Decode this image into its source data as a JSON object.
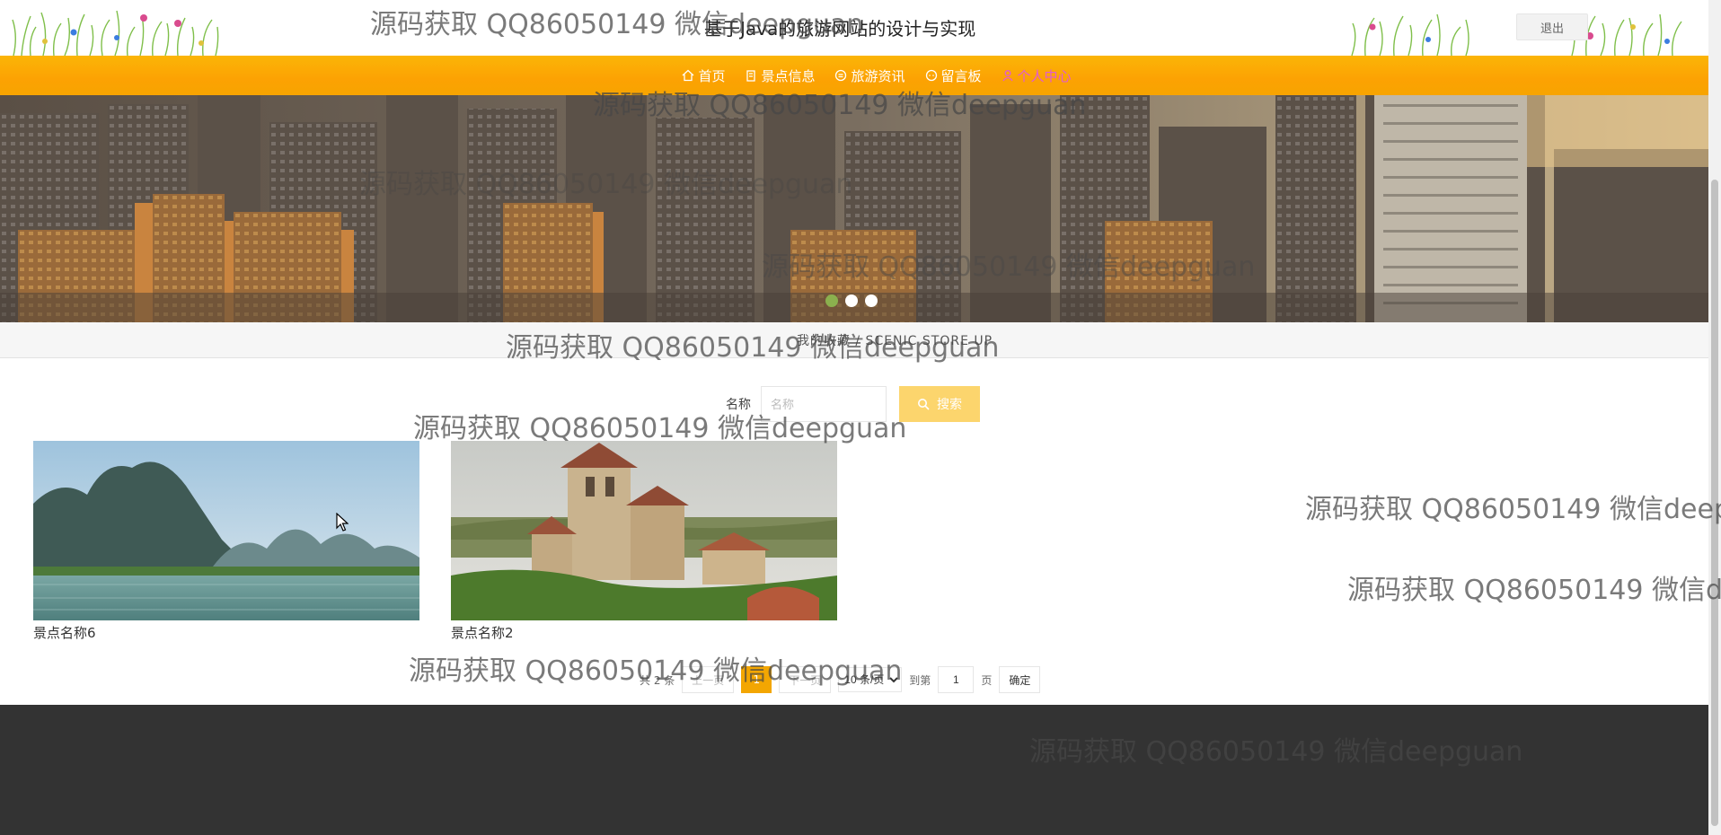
{
  "header": {
    "title": "基于Java的旅游网站的设计与实现",
    "logout_label": "退出"
  },
  "nav": {
    "items": [
      {
        "label": "首页",
        "icon": "home-icon"
      },
      {
        "label": "景点信息",
        "icon": "building-icon"
      },
      {
        "label": "旅游资讯",
        "icon": "news-icon"
      },
      {
        "label": "留言板",
        "icon": "message-icon"
      },
      {
        "label": "个人中心",
        "icon": "user-icon"
      }
    ],
    "active_index": 4
  },
  "banner": {
    "slide_count": 3,
    "active_slide": 0
  },
  "subbar": {
    "text": "我的收藏 / SCENIC STORE UP"
  },
  "search": {
    "label": "名称",
    "placeholder": "名称",
    "value": "",
    "button_label": "搜索",
    "button_icon": "search-icon"
  },
  "cards": [
    {
      "name": "景点名称6"
    },
    {
      "name": "景点名称2"
    }
  ],
  "pagination": {
    "total_text": "共 2 条",
    "prev_label": "上一页",
    "current_page": "1",
    "next_label": "下一页",
    "page_size_selected": "10 条/页",
    "goto_label": "到第",
    "goto_value": "1",
    "page_unit": "页",
    "confirm_label": "确定"
  },
  "watermark": {
    "text": "源码获取 QQ86050149 微信deepguan"
  },
  "colors": {
    "nav_orange": "#fca203",
    "active_nav": "#e25bd1",
    "search_button": "#fcd56d",
    "current_page": "#f3a602",
    "footer": "#333333",
    "active_dot": "#8bb04e"
  }
}
